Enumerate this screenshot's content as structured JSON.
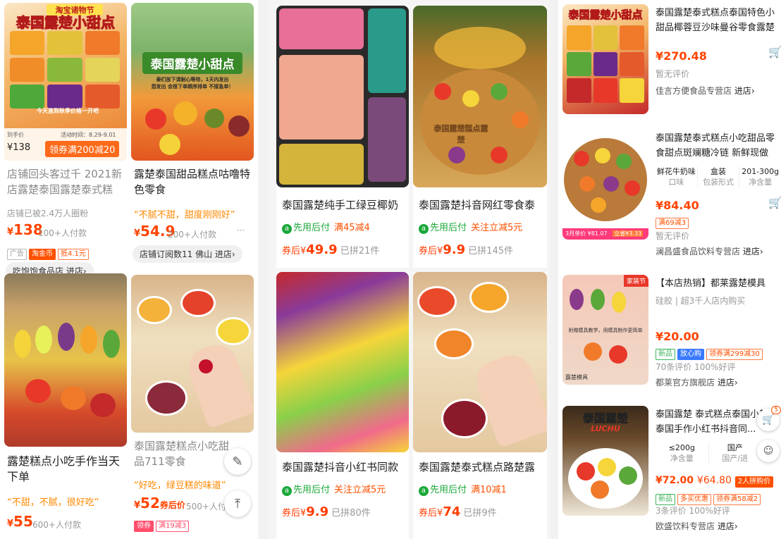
{
  "colors": {
    "price": "#ff4400",
    "green": "#1ba83a",
    "orange_text": "#ff8800"
  },
  "panel1": {
    "card1": {
      "overlay_top": "淘宝诸物节",
      "overlay_title": "泰国露楚小甜点",
      "overlay_sub": "今天直到秋季价格一开吧",
      "img_price_label": "到手价",
      "img_price": "¥138",
      "img_date": "活动时间：8.29-9.01",
      "img_coupon": "领券满200减20",
      "title": "店铺回头客过千 2021新店露楚泰国露楚泰式糕",
      "fans": "店铺已被2.4万人圈粉",
      "price_cur": "¥",
      "price_num": "138",
      "sold": "100+人付款",
      "tags": [
        "广告",
        "淘金币",
        "抵4.1元"
      ],
      "shop": "吃饱饱食品店",
      "shop_link": "进店›"
    },
    "card2": {
      "overlay_title": "泰国露楚小甜点",
      "overlay_line1": "泰们放下请耐心等待，1天内发出",
      "overlay_line2": "您发出 会很下单顺序排单 不接急单！",
      "title": "露楚泰国甜品糕点咕噜特色零食",
      "slogan": "“不腻不甜，甜度刚刚好”",
      "price_cur": "¥",
      "price_num": "54.9",
      "sold": "200+人付款",
      "shop_pill": "店铺订阅数11 佛山 进店›"
    },
    "card3": {
      "title": "露楚糕点小吃手作当天下单",
      "slogan": "“不甜，不腻，很好吃”",
      "price_cur": "¥",
      "price_num": "55",
      "sold": "600+人付款"
    },
    "card4": {
      "title": "泰国露楚糕点小吃甜品711零食",
      "slogan": "“好吃，绿豆糕的味道”",
      "price_cur": "¥",
      "price_num": "52",
      "price_suffix": "券后价",
      "sold": "500+人付",
      "tags": [
        "领券",
        "满19减3"
      ]
    },
    "float_edit_icon": "edit-icon",
    "float_top_icon": "back-to-top-icon"
  },
  "panel2": {
    "c1": {
      "title": "泰国露楚纯手工绿豆椰奶",
      "pay": "先用后付",
      "promo": "满45减4",
      "after": "券后¥",
      "after_num": "49.9",
      "sold": "已拼21件"
    },
    "c2": {
      "title": "泰国露楚抖音网红零食泰",
      "pay": "先用后付",
      "promo": "关注立减5元",
      "after": "券后¥",
      "after_num": "9.9",
      "sold": "已拼145件"
    },
    "c3": {
      "title": "泰国露楚抖音小红书同款",
      "pay": "先用后付",
      "promo": "关注立减5元",
      "after": "券后¥",
      "after_num": "9.9",
      "sold": "已拼80件"
    },
    "c4": {
      "title": "泰国露楚泰式糕点路楚露",
      "pay": "先用后付",
      "promo": "满10减1",
      "after": "券后¥",
      "after_num": "74",
      "sold": "已拼9件"
    },
    "c2_overlay": "泰国露楚糕点露楚"
  },
  "panel3": {
    "r1": {
      "img_title": "泰国露楚小甜点",
      "title": "泰国露楚泰式糕点泰国特色小甜品椰蓉豆沙味曼谷零食露楚糕...",
      "price": "¥270.48",
      "review": "暂无评价",
      "shop": "佳言方便食品专营店",
      "shop_link": "进店›"
    },
    "r2": {
      "title": "泰国露楚泰式糕点小吃甜品零食甜点斑斓糖冷链 新鲜现做 (露...",
      "specs": [
        {
          "v": "鲜花牛奶味",
          "k": "口味"
        },
        {
          "v": "盒装",
          "k": "包装形式"
        },
        {
          "v": "201-300g",
          "k": "净含量"
        }
      ],
      "price": "¥84.40",
      "tag": "满69减3",
      "member_price": "3月单价 ¥81.07",
      "member_tag": "立省¥3.33",
      "review": "暂无评价",
      "shop": "澜昌盛食品饮料专营店",
      "shop_link": "进店›"
    },
    "r3": {
      "img_badge": "家装节",
      "img_text": "附赠模具教学，用模具制作更简单",
      "img_label": "露楚模具",
      "title": "【本店热销】都莱露楚模具泰...",
      "sub": "硅胶 | 超3千人店内购买",
      "price": "¥20.00",
      "tags": [
        "新品",
        "放心购",
        "领券满299减30"
      ],
      "review": "70条评价 100%好评",
      "shop": "都莱官方旗舰店",
      "shop_link": "进店›"
    },
    "r4": {
      "img_title": "泰国露楚",
      "img_sub": "LUCHU",
      "title": "泰国露楚 泰式糕点泰国小楚泰国手作小红书抖音同...",
      "specs": [
        {
          "v": "≤200g",
          "k": "净含量"
        },
        {
          "v": "国产",
          "k": "国产/进"
        }
      ],
      "price": "¥72.00",
      "price2": "¥64.80",
      "tag_hot": "2人拼购价",
      "tags": [
        "新品",
        "多买优惠",
        "领券满58减2"
      ],
      "review": "3条评价 100%好评",
      "shop": "欧盛饮料专营店",
      "shop_link": "进店›",
      "cart_badge": "5"
    }
  }
}
